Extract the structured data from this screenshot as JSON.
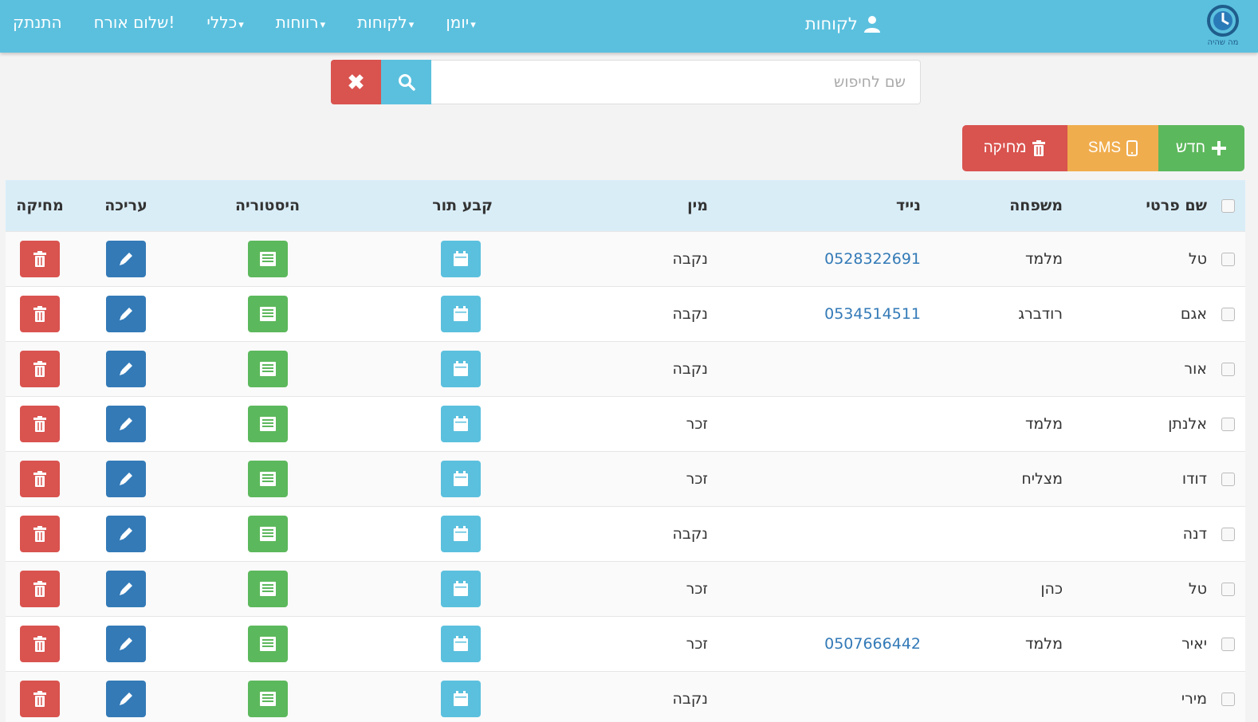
{
  "nav": {
    "logo_text": "מה שהיה",
    "brand": "לקוחות",
    "menu": [
      {
        "label": "התנתק",
        "caret": false
      },
      {
        "label": "שלום אורח!",
        "caret": false
      },
      {
        "label": "כללי",
        "caret": true
      },
      {
        "label": "רווחות",
        "caret": true
      },
      {
        "label": "לקוחות",
        "caret": true
      },
      {
        "label": "יומן",
        "caret": true
      }
    ]
  },
  "search": {
    "placeholder": "שם לחיפוש",
    "value": ""
  },
  "actions": {
    "delete_label": "מחיקה",
    "sms_label": "SMS",
    "new_label": "חדש"
  },
  "table": {
    "headers": {
      "first_name": "שם פרטי",
      "last_name": "משפחה",
      "mobile": "נייד",
      "gender": "מין",
      "appointment": "קבע תור",
      "history": "היסטוריה",
      "edit": "עריכה",
      "delete": "מחיקה"
    },
    "rows": [
      {
        "first_name": "טל",
        "last_name": "מלמד",
        "mobile": "0528322691",
        "gender": "נקבה"
      },
      {
        "first_name": "אגם",
        "last_name": "רודברג",
        "mobile": "0534514511",
        "gender": "נקבה"
      },
      {
        "first_name": "אור",
        "last_name": "",
        "mobile": "",
        "gender": "נקבה"
      },
      {
        "first_name": "אלנתן",
        "last_name": "מלמד",
        "mobile": "",
        "gender": "זכר"
      },
      {
        "first_name": "דודו",
        "last_name": "מצליח",
        "mobile": "",
        "gender": "זכר"
      },
      {
        "first_name": "דנה",
        "last_name": "",
        "mobile": "",
        "gender": "נקבה"
      },
      {
        "first_name": "טל",
        "last_name": "כהן",
        "mobile": "",
        "gender": "זכר"
      },
      {
        "first_name": "יאיר",
        "last_name": "מלמד",
        "mobile": "0507666442",
        "gender": "זכר"
      },
      {
        "first_name": "מירי",
        "last_name": "",
        "mobile": "",
        "gender": "נקבה"
      }
    ]
  },
  "colors": {
    "navbar": "#5bc0de",
    "danger": "#d9534f",
    "warning": "#f0ad4e",
    "success": "#5cb85c",
    "primary": "#337ab7",
    "info": "#5bc0de"
  }
}
